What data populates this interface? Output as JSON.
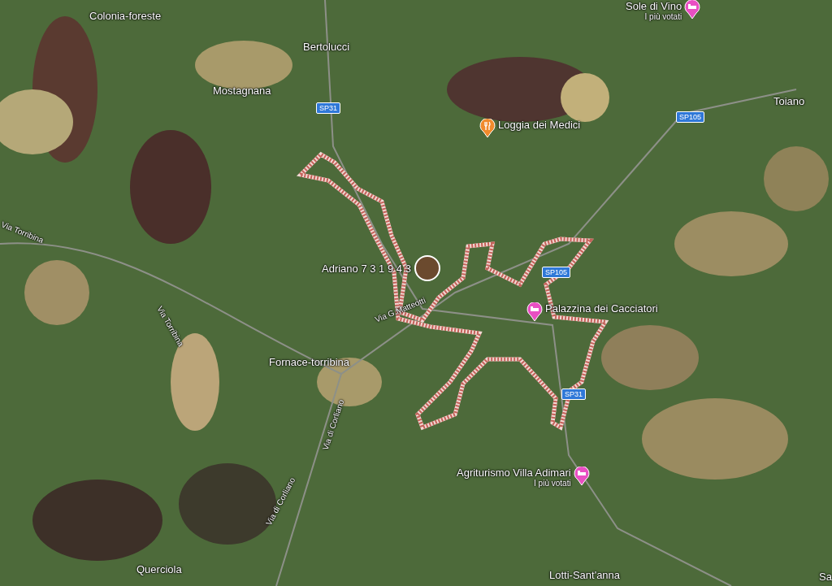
{
  "places": [
    {
      "name": "Colonia-foreste"
    },
    {
      "name": "Bertolucci"
    },
    {
      "name": "Mostagnana"
    },
    {
      "name": "Toiano"
    },
    {
      "name": "Fornace-torribina"
    },
    {
      "name": "Querciola"
    },
    {
      "name": "Lotti-Sant'anna"
    },
    {
      "name": "Sa"
    }
  ],
  "road_shields": [
    {
      "label": "SP31"
    },
    {
      "label": "SP105"
    },
    {
      "label": "SP105"
    },
    {
      "label": "SP31"
    }
  ],
  "streets": [
    {
      "label": "Via Torribina"
    },
    {
      "label": "Via Torribina"
    },
    {
      "label": "Via G.Matteotti"
    },
    {
      "label": "Via di Corliano"
    },
    {
      "label": "Via di Corliano"
    }
  ],
  "pois": [
    {
      "kind": "hotel",
      "name": "Sole di Vino",
      "subtitle": "I più votati"
    },
    {
      "kind": "restaurant",
      "name": "Loggia dei Medici"
    },
    {
      "kind": "hotel",
      "name": "Palazzina dei Cacciatori"
    },
    {
      "kind": "hotel",
      "name": "Agriturismo Villa Adimari",
      "subtitle": "I più votati"
    }
  ],
  "photo_marker": {
    "label": "Adriano 7 3 1 9 4 3"
  }
}
